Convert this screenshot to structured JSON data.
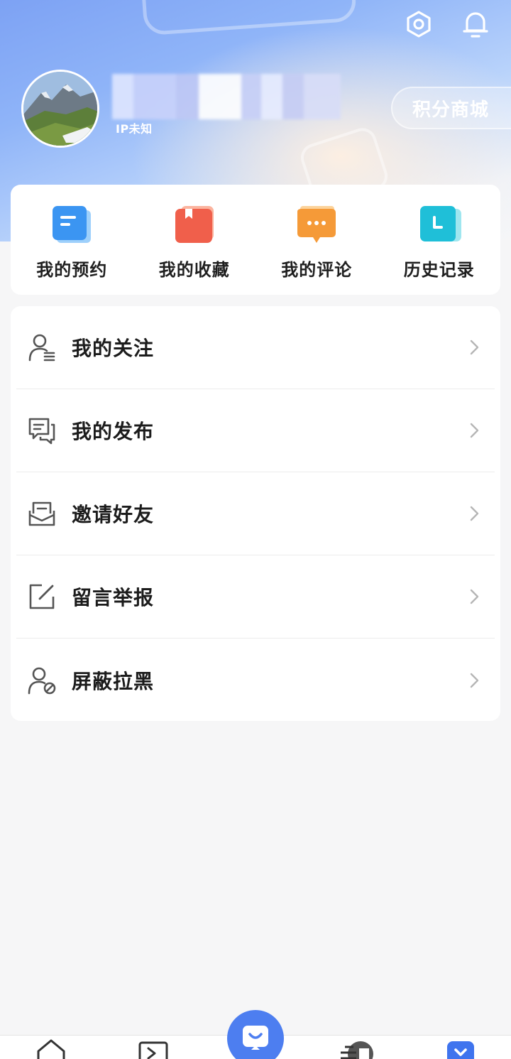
{
  "header": {
    "settings_icon": "settings-hexagon-icon",
    "notification_icon": "bell-icon",
    "ip_label": "IP未知",
    "points_mall_label": "积分商城"
  },
  "quick_actions": [
    {
      "label": "我的预约",
      "icon": "appointment-icon",
      "color": "#3b95f2"
    },
    {
      "label": "我的收藏",
      "icon": "bookmark-icon",
      "color": "#f05f4b"
    },
    {
      "label": "我的评论",
      "icon": "comment-icon",
      "color": "#f59a38"
    },
    {
      "label": "历史记录",
      "icon": "clock-history-icon",
      "color": "#1fbfd8"
    }
  ],
  "menu": [
    {
      "label": "我的关注",
      "icon": "user-list-icon"
    },
    {
      "label": "我的发布",
      "icon": "chat-bubbles-icon"
    },
    {
      "label": "邀请好友",
      "icon": "envelope-icon"
    },
    {
      "label": "留言举报",
      "icon": "edit-icon"
    },
    {
      "label": "屏蔽拉黑",
      "icon": "user-block-icon"
    }
  ],
  "tabbar": {
    "active_color": "#4d7ef0",
    "tabs": [
      "home-icon",
      "play-icon",
      "message-icon",
      "news-icon",
      "me-icon"
    ]
  }
}
